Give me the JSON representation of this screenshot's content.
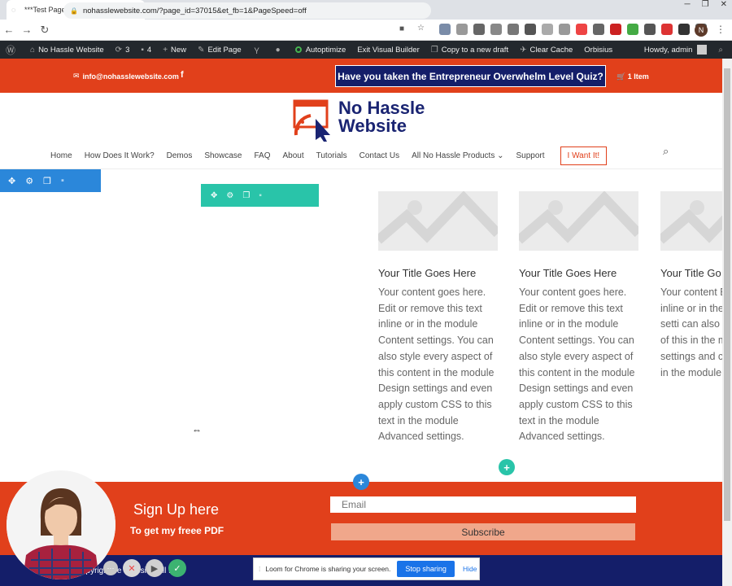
{
  "browser": {
    "tab_title": "***Test Page*** - No Hassle Web",
    "tab_close": "×",
    "new_tab": "+",
    "url": "nohasslewebsite.com/?page_id=37015&et_fb=1&PageSpeed=off"
  },
  "adminbar": {
    "site_name": "No Hassle Website",
    "updates_count": "3",
    "comments_count": "4",
    "new_label": "New",
    "edit_page": "Edit Page",
    "autoptimize": "Autoptimize",
    "exit_builder": "Exit Visual Builder",
    "copy_draft": "Copy to a new draft",
    "clear_cache": "Clear Cache",
    "orbisius": "Orbisius",
    "howdy": "Howdy, admin"
  },
  "topbar": {
    "email": "info@nohasslewebsite.com",
    "facebook_glyph": "f",
    "quiz_button": "Have you taken the Entrepreneur Overwhelm Level Quiz?",
    "cart": "1 Item"
  },
  "logo": {
    "line1": "No Hassle",
    "line2": "Website"
  },
  "menu": {
    "items": [
      "Home",
      "How Does It Work?",
      "Demos",
      "Showcase",
      "FAQ",
      "About",
      "Tutorials",
      "Contact Us",
      "All No Hassle Products",
      "Support"
    ],
    "cta": "I Want It!"
  },
  "cards": [
    {
      "title": "Your Title Goes Here",
      "body": "Your content goes here. Edit or remove this text inline or in the module Content settings. You can also style every aspect of this content in the module Design settings and even apply custom CSS to this text in the module Advanced settings."
    },
    {
      "title": "Your Title Goes Here",
      "body": "Your content goes here. Edit or remove this text inline or in the module Content settings. You can also style every aspect of this content in the module Design settings and even apply custom CSS to this text in the module Advanced settings."
    },
    {
      "title": "Your Title Go",
      "body": "Your content Edit or remov inline or in the Content setti can also style aspect of this in the module D settings and custom CSS t in the module settings."
    }
  ],
  "signup": {
    "title": "Sign Up here",
    "subtitle": "To get my freee PDF",
    "email_placeholder": "Email",
    "button": "Subscribe"
  },
  "footer": {
    "copyright": "opyrigh  2  e Website. All Ri"
  },
  "loom": {
    "message": "Loom for Chrome is sharing your screen.",
    "stop": "Stop sharing",
    "hide": "Hide"
  },
  "colors": {
    "brand_orange": "#e1401b",
    "brand_navy": "#141e69",
    "divi_blue": "#2b87da",
    "divi_teal": "#29c4a9"
  }
}
